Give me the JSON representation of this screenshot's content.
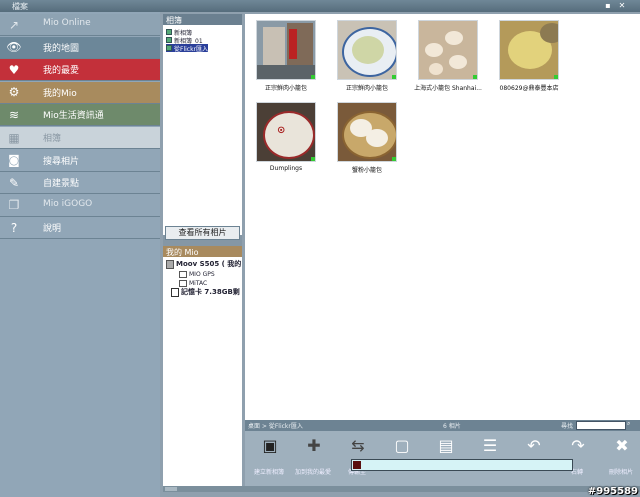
{
  "window": {
    "title": "檔案"
  },
  "sidebar": {
    "items": [
      {
        "label": "Mio Online",
        "icon": "mio-online-icon",
        "bg": "#8ea3b3",
        "fg": "#e2e8ed"
      },
      {
        "label": "我的地圖",
        "icon": "eye-icon",
        "bg": "#6c8799",
        "fg": "#ffffff"
      },
      {
        "label": "我的最愛",
        "icon": "heart-icon",
        "bg": "#c3303a",
        "fg": "#ffffff"
      },
      {
        "label": "我的Mio",
        "icon": "gear-icon",
        "bg": "#a88b5e",
        "fg": "#ffffff"
      },
      {
        "label": "Mio生活資訊通",
        "icon": "lifestyle-icon",
        "bg": "#6e8a6b",
        "fg": "#ffffff"
      },
      {
        "label": "相簿",
        "icon": "album-icon",
        "bg": "#c9d3da",
        "fg": "#8a98a4"
      },
      {
        "label": "搜尋相片",
        "icon": "camera-icon",
        "bg": "#91a6b7",
        "fg": "#ffffff"
      },
      {
        "label": "自建景點",
        "icon": "pin-icon",
        "bg": "#91a6b7",
        "fg": "#ffffff"
      },
      {
        "label": "Mio iGOGO",
        "icon": "book-icon",
        "bg": "#91a6b7",
        "fg": "#e2e8ed"
      },
      {
        "label": "說明",
        "icon": "question-icon",
        "bg": "#91a6b7",
        "fg": "#ffffff"
      }
    ]
  },
  "albums": {
    "header": "相簿",
    "items": [
      "新相簿",
      "新相簿_01",
      "從Flickr匯入"
    ],
    "selected_index": 2,
    "view_all_label": "查看所有相片"
  },
  "mio": {
    "header": "我的 Mio",
    "device": "Moov S505 ( 我的",
    "folders": [
      "MIO GPS",
      "MiTAC"
    ],
    "card": "記憶卡 7.38GB剩"
  },
  "photos": [
    {
      "caption": "正宗鮮肉小籠包",
      "scene": "street"
    },
    {
      "caption": "正宗鮮肉小籠包",
      "scene": "plate"
    },
    {
      "caption": "上海式小籠包 Shanhai...",
      "scene": "dumplings"
    },
    {
      "caption": "080629@鼎泰豐本店",
      "scene": "dumpling-close"
    },
    {
      "caption": "Dumplings",
      "scene": "sign"
    },
    {
      "caption": "蟹粉小籠包",
      "scene": "steamer"
    }
  ],
  "status": {
    "breadcrumb": "桌面 > 從Flickr匯入",
    "count": "6 相片",
    "search_label": "尋找"
  },
  "toolbar": {
    "buttons": [
      {
        "label": "建立新相簿",
        "icon": "new-album-icon"
      },
      {
        "label": "加到我的最愛",
        "icon": "add-favorite-icon"
      },
      {
        "label": "傳輸至",
        "icon": "transfer-icon"
      },
      {
        "label": "",
        "icon": "single-view-icon"
      },
      {
        "label": "",
        "icon": "slideshow-icon"
      },
      {
        "label": "",
        "icon": "list-view-icon"
      },
      {
        "label": "",
        "icon": "rotate-left-icon"
      },
      {
        "label": "右轉",
        "icon": "rotate-right-icon"
      },
      {
        "label": "刪除相片",
        "icon": "delete-photo-icon"
      }
    ]
  },
  "watermark": "#995589"
}
